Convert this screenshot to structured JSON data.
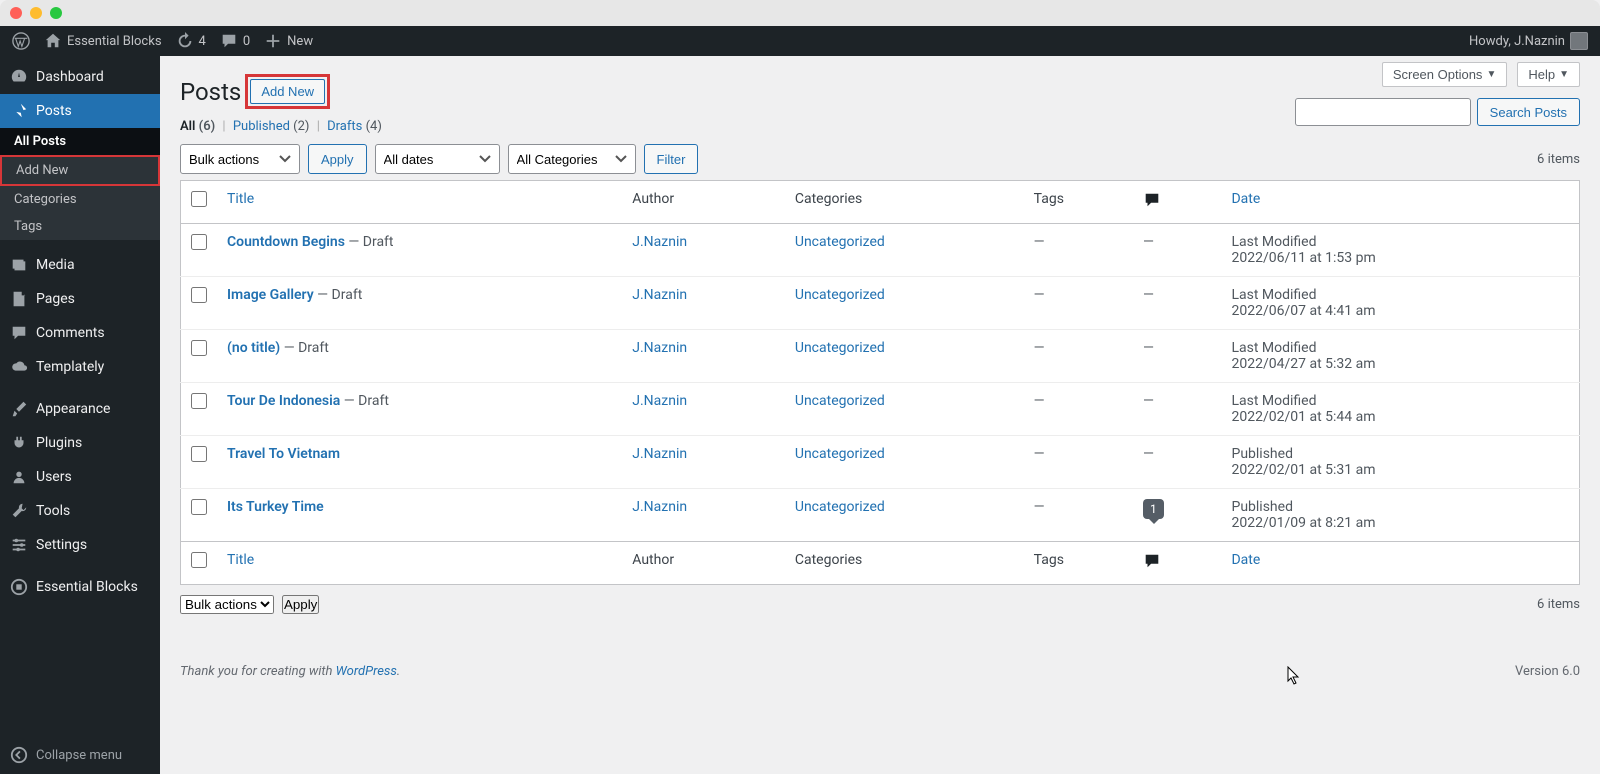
{
  "adminbar": {
    "site_name": "Essential Blocks",
    "updates_count": "4",
    "comments_count": "0",
    "new_label": "New",
    "howdy": "Howdy, J.Naznin"
  },
  "sidebar": {
    "dashboard": "Dashboard",
    "posts": "Posts",
    "sub": {
      "all_posts": "All Posts",
      "add_new": "Add New",
      "categories": "Categories",
      "tags": "Tags"
    },
    "media": "Media",
    "pages": "Pages",
    "comments": "Comments",
    "templately": "Templately",
    "appearance": "Appearance",
    "plugins": "Plugins",
    "users": "Users",
    "tools": "Tools",
    "settings": "Settings",
    "essential_blocks": "Essential Blocks",
    "collapse": "Collapse menu"
  },
  "screen_options": "Screen Options",
  "help": "Help",
  "page_title": "Posts",
  "add_new": "Add New",
  "views": {
    "all_label": "All",
    "all_count": "(6)",
    "published_label": "Published",
    "published_count": "(2)",
    "drafts_label": "Drafts",
    "drafts_count": "(4)"
  },
  "search_label": "Search Posts",
  "bulk_actions": "Bulk actions",
  "apply": "Apply",
  "all_dates": "All dates",
  "all_categories": "All Categories",
  "filter": "Filter",
  "items_count": "6 items",
  "columns": {
    "title": "Title",
    "author": "Author",
    "categories": "Categories",
    "tags": "Tags",
    "date": "Date"
  },
  "rows": [
    {
      "title": "Countdown Begins",
      "state": " — Draft",
      "author": "J.Naznin",
      "cat": "Uncategorized",
      "tags": "—",
      "comments": "—",
      "date_line1": "Last Modified",
      "date_line2": "2022/06/11 at 1:53 pm"
    },
    {
      "title": "Image Gallery",
      "state": " — Draft",
      "author": "J.Naznin",
      "cat": "Uncategorized",
      "tags": "—",
      "comments": "—",
      "date_line1": "Last Modified",
      "date_line2": "2022/06/07 at 4:41 am"
    },
    {
      "title": "(no title)",
      "state": " — Draft",
      "author": "J.Naznin",
      "cat": "Uncategorized",
      "tags": "—",
      "comments": "—",
      "date_line1": "Last Modified",
      "date_line2": "2022/04/27 at 5:32 am"
    },
    {
      "title": "Tour De Indonesia",
      "state": " — Draft",
      "author": "J.Naznin",
      "cat": "Uncategorized",
      "tags": "—",
      "comments": "—",
      "date_line1": "Last Modified",
      "date_line2": "2022/02/01 at 5:44 am"
    },
    {
      "title": "Travel To Vietnam",
      "state": "",
      "author": "J.Naznin",
      "cat": "Uncategorized",
      "tags": "—",
      "comments": "—",
      "date_line1": "Published",
      "date_line2": "2022/02/01 at 5:31 am"
    },
    {
      "title": "Its Turkey Time",
      "state": "",
      "author": "J.Naznin",
      "cat": "Uncategorized",
      "tags": "—",
      "comments": "1",
      "date_line1": "Published",
      "date_line2": "2022/01/09 at 8:21 am"
    }
  ],
  "footer": {
    "thank_you_prefix": "Thank you for creating with ",
    "wp_link": "WordPress",
    "period": ".",
    "version": "Version 6.0"
  }
}
